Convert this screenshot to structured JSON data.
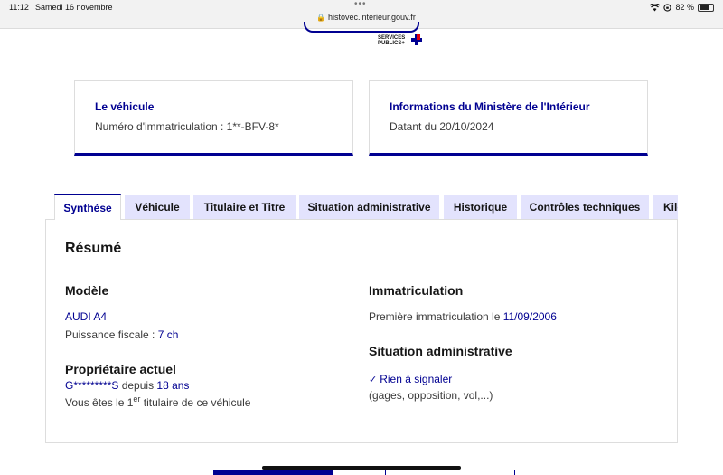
{
  "status_bar": {
    "time": "11:12",
    "date": "Samedi 16 novembre",
    "url": "histovec.interieur.gouv.fr",
    "battery": "82 %",
    "battery_level": 0.82
  },
  "header": {
    "logo_line1": "SERVICES",
    "logo_line2": "PUBLICS+"
  },
  "cards": {
    "vehicle": {
      "title": "Le véhicule",
      "text": "Numéro d'immatriculation : 1**-BFV-8*"
    },
    "ministry": {
      "title": "Informations du Ministère de l'Intérieur",
      "text": "Datant du 20/10/2024"
    }
  },
  "tabs": [
    {
      "label": "Synthèse",
      "active": true
    },
    {
      "label": "Véhicule",
      "active": false
    },
    {
      "label": "Titulaire et Titre",
      "active": false
    },
    {
      "label": "Situation administrative",
      "active": false
    },
    {
      "label": "Historique",
      "active": false
    },
    {
      "label": "Contrôles techniques",
      "active": false
    },
    {
      "label": "Kilo",
      "active": false
    }
  ],
  "summary": {
    "title": "Résumé",
    "model": {
      "heading": "Modèle",
      "name": "AUDI A4",
      "power_label": "Puissance fiscale : ",
      "power_value": "7 ch"
    },
    "owner": {
      "heading": "Propriétaire actuel",
      "name": "G*********S",
      "since_label": " depuis ",
      "since_value": "18 ans",
      "rank_prefix": "Vous êtes le 1",
      "rank_sup": "er",
      "rank_suffix": " titulaire de ce véhicule"
    },
    "registration": {
      "heading": "Immatriculation",
      "label": "Première immatriculation le ",
      "date": "11/09/2006"
    },
    "admin": {
      "heading": "Situation administrative",
      "status": "Rien à signaler",
      "details": "(gages, opposition, vol,...)"
    }
  },
  "colors": {
    "primary": "#000091",
    "tab_bg": "#e3e3fd",
    "accent_red": "#e1000f"
  }
}
